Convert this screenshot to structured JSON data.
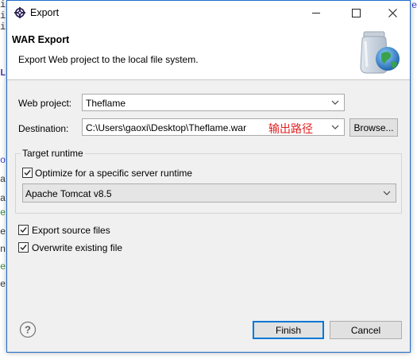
{
  "window": {
    "title": "Export"
  },
  "header": {
    "title": "WAR Export",
    "description": "Export Web project to the local file system."
  },
  "form": {
    "web_project_label": "Web project:",
    "web_project_value": "Theflame",
    "destination_label": "Destination:",
    "destination_value": "C:\\Users\\gaoxi\\Desktop\\Theflame.war",
    "annotation": "输出路径",
    "browse_label": "Browse..."
  },
  "target_runtime": {
    "group_title": "Target runtime",
    "optimize_label": "Optimize for a specific server runtime",
    "optimize_checked": true,
    "runtime_value": "Apache Tomcat v8.5"
  },
  "options": {
    "export_source_label": "Export source files",
    "export_source_checked": true,
    "overwrite_label": "Overwrite existing file",
    "overwrite_checked": true
  },
  "footer": {
    "finish_label": "Finish",
    "cancel_label": "Cancel"
  },
  "colors": {
    "accent": "#0078d7",
    "annotation": "#e02020",
    "dialog_bg": "#f0f0f0"
  },
  "icons": {
    "title": "eclipse-gear-icon",
    "header": "jar-globe-icon",
    "help": "help-icon"
  }
}
